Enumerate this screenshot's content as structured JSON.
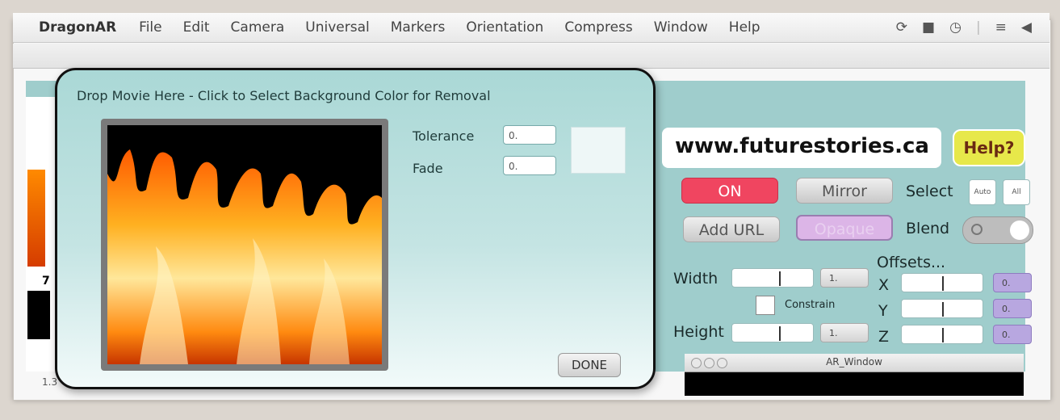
{
  "menubar": {
    "app_name": "DragonAR",
    "items": [
      "File",
      "Edit",
      "Camera",
      "Universal",
      "Markers",
      "Orientation",
      "Compress",
      "Window",
      "Help"
    ],
    "status_icons": [
      "sync-icon",
      "display-icon",
      "clock-icon",
      "wifi-icon",
      "volume-icon"
    ]
  },
  "left_strip": {
    "number": "7",
    "bottom_label": "1.3"
  },
  "dialog": {
    "title": "Drop Movie Here - Click to Select Background Color for Removal",
    "tolerance_label": "Tolerance",
    "tolerance_value": "0.",
    "fade_label": "Fade",
    "fade_value": "0.",
    "done_label": "DONE"
  },
  "panel": {
    "url": "www.futurestories.ca",
    "help_label": "Help?",
    "on_label": "ON",
    "mirror_label": "Mirror",
    "select_label": "Select",
    "select_auto": "Auto",
    "select_all": "All",
    "add_url_label": "Add URL",
    "opaque_label": "Opaque",
    "blend_label": "Blend",
    "width_label": "Width",
    "width_value": "1.",
    "height_label": "Height",
    "height_value": "1.",
    "constrain_label": "Constrain",
    "offsets_label": "Offsets...",
    "x_label": "X",
    "y_label": "Y",
    "z_label": "Z",
    "x_value": "0.",
    "y_value": "0.",
    "z_value": "0."
  },
  "ar_window": {
    "title": "AR_Window"
  },
  "colors": {
    "teal": "#9fcdcc",
    "on_red": "#f04560",
    "help_yellow": "#e7e84a",
    "offset_purple": "#b8a7e0"
  }
}
